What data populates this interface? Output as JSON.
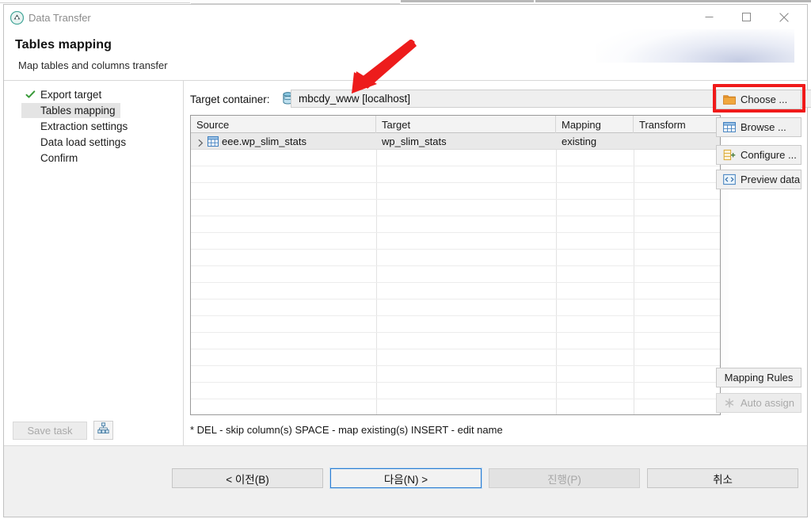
{
  "window": {
    "title": "Data Transfer",
    "app_icon": "data-transfer-icon",
    "controls": {
      "minimize": "minimize-icon",
      "maximize": "maximize-icon",
      "close": "close-icon"
    }
  },
  "header": {
    "title": "Tables mapping",
    "subtitle": "Map tables and columns transfer"
  },
  "sidebar": {
    "items": [
      {
        "label": "Export target",
        "state": "done",
        "icon": "check-icon"
      },
      {
        "label": "Tables mapping",
        "state": "selected",
        "icon": ""
      },
      {
        "label": "Extraction settings",
        "state": "normal",
        "icon": ""
      },
      {
        "label": "Data load settings",
        "state": "normal",
        "icon": ""
      },
      {
        "label": "Confirm",
        "state": "normal",
        "icon": ""
      }
    ]
  },
  "target_container": {
    "label": "Target container:",
    "icon": "database-icon",
    "value": "mbcdy_www  [localhost]",
    "chevron": "chevron-down-icon"
  },
  "table": {
    "columns": [
      "Source",
      "Target",
      "Mapping",
      "Transform"
    ],
    "rows": [
      {
        "expander": "chevron-right-icon",
        "icon": "table-icon",
        "source": "eee.wp_slim_stats",
        "target": "wp_slim_stats",
        "mapping": "existing",
        "transform": ""
      }
    ]
  },
  "side_buttons": [
    {
      "label": "Choose ...",
      "icon": "folder-icon",
      "enabled": true,
      "highlighted": true
    },
    {
      "label": "Browse ...",
      "icon": "table-icon",
      "enabled": true,
      "highlighted": false
    },
    {
      "label": "Configure ...",
      "icon": "configure-icon",
      "enabled": true,
      "highlighted": false
    },
    {
      "label": "Preview data",
      "icon": "code-icon",
      "enabled": true,
      "highlighted": false
    }
  ],
  "bottom_side_buttons": [
    {
      "label": "Mapping Rules",
      "icon": "",
      "enabled": true
    },
    {
      "label": "Auto assign",
      "icon": "asterisk-icon",
      "enabled": false
    }
  ],
  "hint": "* DEL - skip column(s)  SPACE - map existing(s)  INSERT - edit name",
  "save_task": {
    "label": "Save task",
    "enabled": false,
    "icon": "save-icon"
  },
  "footer": {
    "buttons": [
      {
        "label": "< 이전(B)",
        "state": "normal",
        "mnemonic": "B"
      },
      {
        "label": "다음(N) >",
        "state": "default",
        "mnemonic": "N"
      },
      {
        "label": "진행(P)",
        "state": "disabled",
        "mnemonic": "P"
      },
      {
        "label": "취소",
        "state": "normal",
        "mnemonic": ""
      }
    ]
  },
  "annotations": {
    "arrow_color": "#ed1c1c",
    "highlight_color": "#f01a1a"
  }
}
